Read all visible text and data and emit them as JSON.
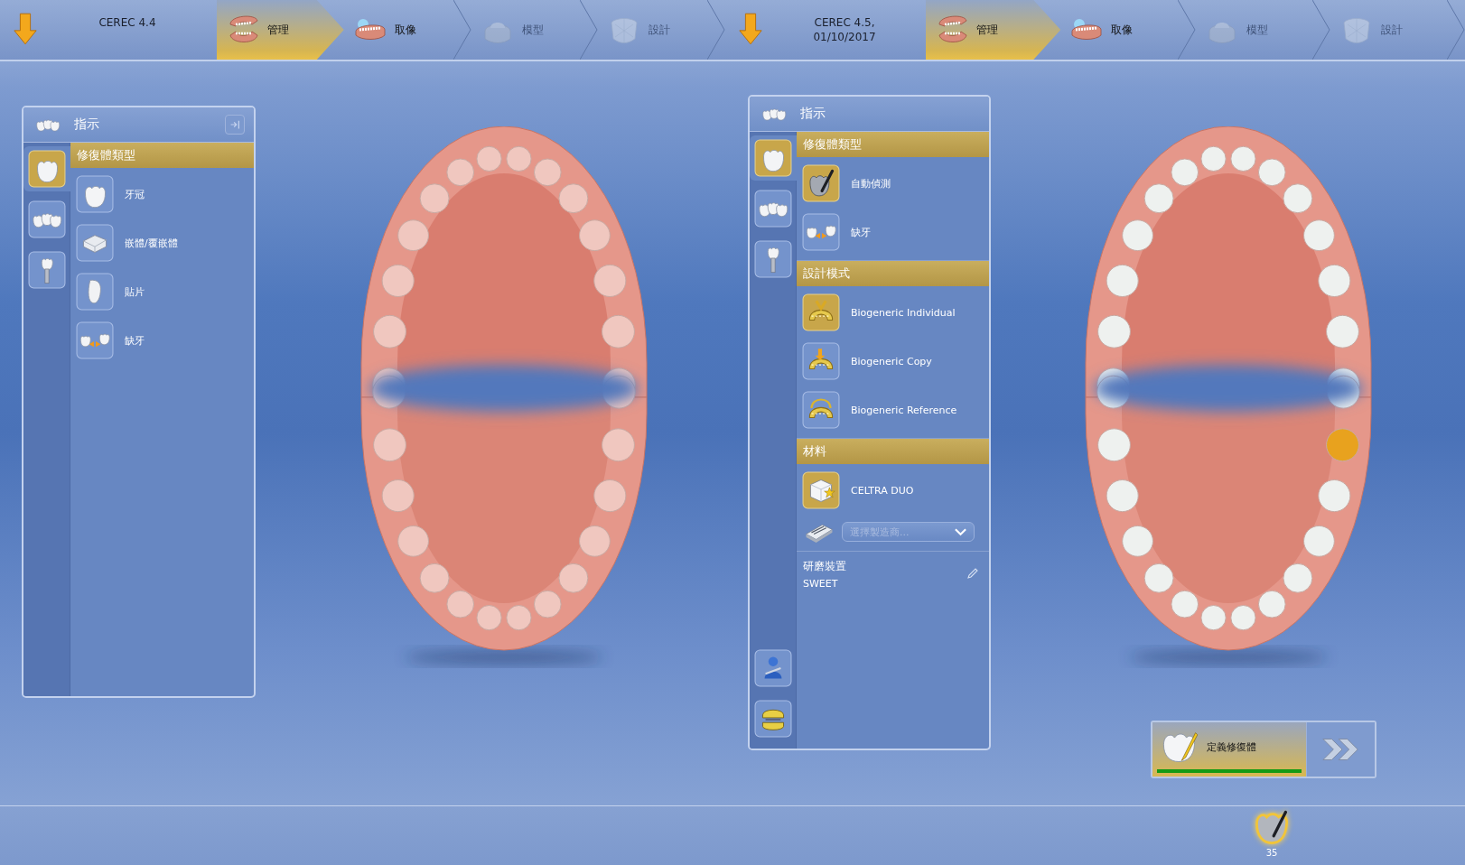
{
  "screens": [
    {
      "header": {
        "title_lines": [
          "CEREC 4.4"
        ],
        "steps": [
          {
            "kind": "manage",
            "label": "管理",
            "selected": true,
            "disabled": false
          },
          {
            "kind": "acquire",
            "label": "取像",
            "selected": false,
            "disabled": false
          },
          {
            "kind": "model",
            "label": "模型",
            "selected": false,
            "disabled": true
          },
          {
            "kind": "design",
            "label": "設計",
            "selected": false,
            "disabled": true
          }
        ]
      },
      "panel": {
        "title": "指示",
        "collapse_button": true,
        "side_tabs": [
          {
            "kind": "crown",
            "selected": true
          },
          {
            "kind": "bridge",
            "selected": false
          },
          {
            "kind": "implant",
            "selected": false
          }
        ],
        "sections": [
          {
            "title": "修復體類型",
            "items": [
              {
                "kind": "crown",
                "label": "牙冠",
                "selected": false
              },
              {
                "kind": "inlay",
                "label": "嵌體/覆嵌體",
                "selected": false
              },
              {
                "kind": "veneer",
                "label": "貼片",
                "selected": false
              },
              {
                "kind": "gap",
                "label": "缺牙",
                "selected": false
              }
            ]
          }
        ]
      },
      "arch": {
        "marked_tooth": false
      }
    },
    {
      "header": {
        "title_lines": [
          "CEREC 4.5,",
          "01/10/2017"
        ],
        "steps": [
          {
            "kind": "manage",
            "label": "管理",
            "selected": true,
            "disabled": false
          },
          {
            "kind": "acquire",
            "label": "取像",
            "selected": false,
            "disabled": false
          },
          {
            "kind": "model",
            "label": "模型",
            "selected": false,
            "disabled": true
          },
          {
            "kind": "design",
            "label": "設計",
            "selected": false,
            "disabled": true
          }
        ]
      },
      "panel": {
        "title": "指示",
        "side_tabs": [
          {
            "kind": "crown",
            "selected": true
          },
          {
            "kind": "bridge",
            "selected": false
          },
          {
            "kind": "implant",
            "selected": false
          }
        ],
        "bottom_tabs": [
          {
            "kind": "figure"
          },
          {
            "kind": "scanner"
          }
        ],
        "sections": [
          {
            "title": "修復體類型",
            "items": [
              {
                "kind": "auto-detect",
                "label": "自動偵測",
                "selected": true
              },
              {
                "kind": "gap",
                "label": "缺牙",
                "selected": false
              }
            ]
          },
          {
            "title": "設計模式",
            "items": [
              {
                "kind": "bio-individual",
                "label": "Biogeneric Individual",
                "selected": true
              },
              {
                "kind": "bio-copy",
                "label": "Biogeneric Copy",
                "selected": false
              },
              {
                "kind": "bio-reference",
                "label": "Biogeneric Reference",
                "selected": false
              }
            ]
          },
          {
            "title": "材料",
            "items": [
              {
                "kind": "block",
                "label": "CELTRA DUO",
                "selected": true
              }
            ]
          }
        ],
        "manufacturer_select": {
          "placeholder": "選擇製造商..."
        },
        "mill": {
          "label": "研磨裝置",
          "value": "SWEET"
        }
      },
      "arch": {
        "marked_tooth": true
      },
      "action": {
        "label": "定義修復體",
        "level": 1
      },
      "tooth_badge": {
        "number": "35"
      }
    }
  ]
}
